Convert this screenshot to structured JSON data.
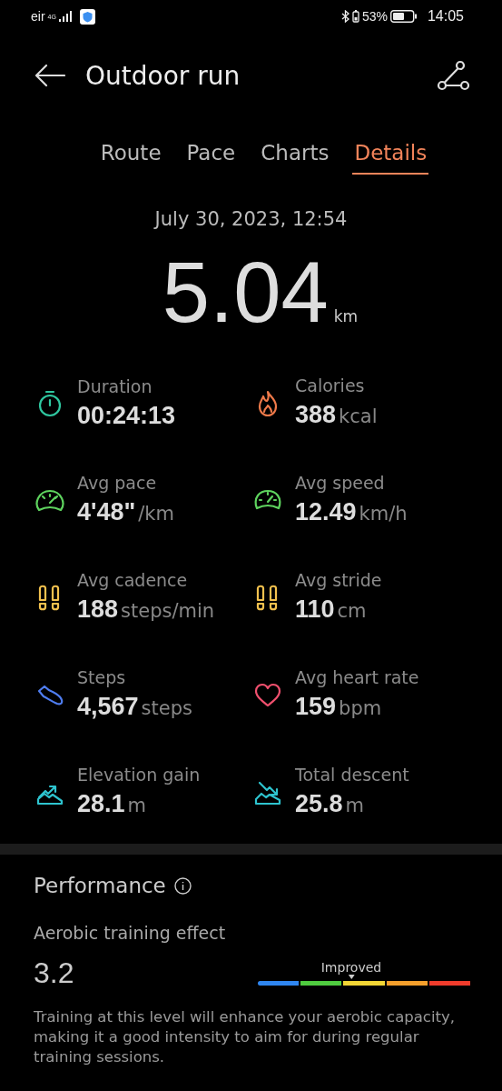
{
  "status_bar": {
    "carrier": "eir",
    "network": "4G",
    "battery_percent": "53%",
    "time": "14:05"
  },
  "header": {
    "title": "Outdoor run"
  },
  "tabs": [
    {
      "label": "Route",
      "selected": false
    },
    {
      "label": "Pace",
      "selected": false
    },
    {
      "label": "Charts",
      "selected": false
    },
    {
      "label": "Details",
      "selected": true
    }
  ],
  "summary": {
    "date": "July 30, 2023, 12:54",
    "distance": "5.04",
    "unit": "km"
  },
  "stats": [
    {
      "kind": "stopwatch",
      "color": "#2fc7a0",
      "label": "Duration",
      "value": "00:24:13"
    },
    {
      "kind": "flame",
      "color": "#f07a4a",
      "label": "Calories",
      "value": "388",
      "unit": "kcal"
    },
    {
      "kind": "gauge",
      "color": "#5ed35e",
      "label": "Avg pace",
      "value": "4'48\"",
      "unit": "/km"
    },
    {
      "kind": "speedometer",
      "color": "#5ed35e",
      "label": "Avg speed",
      "value": "12.49",
      "unit": "km/h"
    },
    {
      "kind": "footprints",
      "color": "#f2c14e",
      "label": "Avg cadence",
      "value": "188",
      "unit": "steps/min"
    },
    {
      "kind": "footprints",
      "color": "#f2c14e",
      "label": "Avg stride",
      "value": "110",
      "unit": "cm"
    },
    {
      "kind": "shoe",
      "color": "#4f7df0",
      "label": "Steps",
      "value": "4,567",
      "unit": "steps"
    },
    {
      "kind": "heart",
      "color": "#f0506e",
      "label": "Avg heart rate",
      "value": "159",
      "unit": "bpm"
    },
    {
      "kind": "ascent",
      "color": "#2ec4cf",
      "label": "Elevation gain",
      "value": "28.1",
      "unit": "m"
    },
    {
      "kind": "descent",
      "color": "#2ec4cf",
      "label": "Total descent",
      "value": "25.8",
      "unit": "m"
    }
  ],
  "performance": {
    "title": "Performance",
    "metric": "Aerobic training effect",
    "value": "3.2",
    "marker_label": "Improved",
    "level": 0.44,
    "segments": [
      {
        "color": "#2f86f0"
      },
      {
        "color": "#4fcc3f"
      },
      {
        "color": "#f2d635"
      },
      {
        "color": "#f5a02c"
      },
      {
        "color": "#f03c2c"
      }
    ],
    "description": "Training at this level will enhance your aerobic capacity, making it a good intensity to aim for during regular training sessions."
  }
}
